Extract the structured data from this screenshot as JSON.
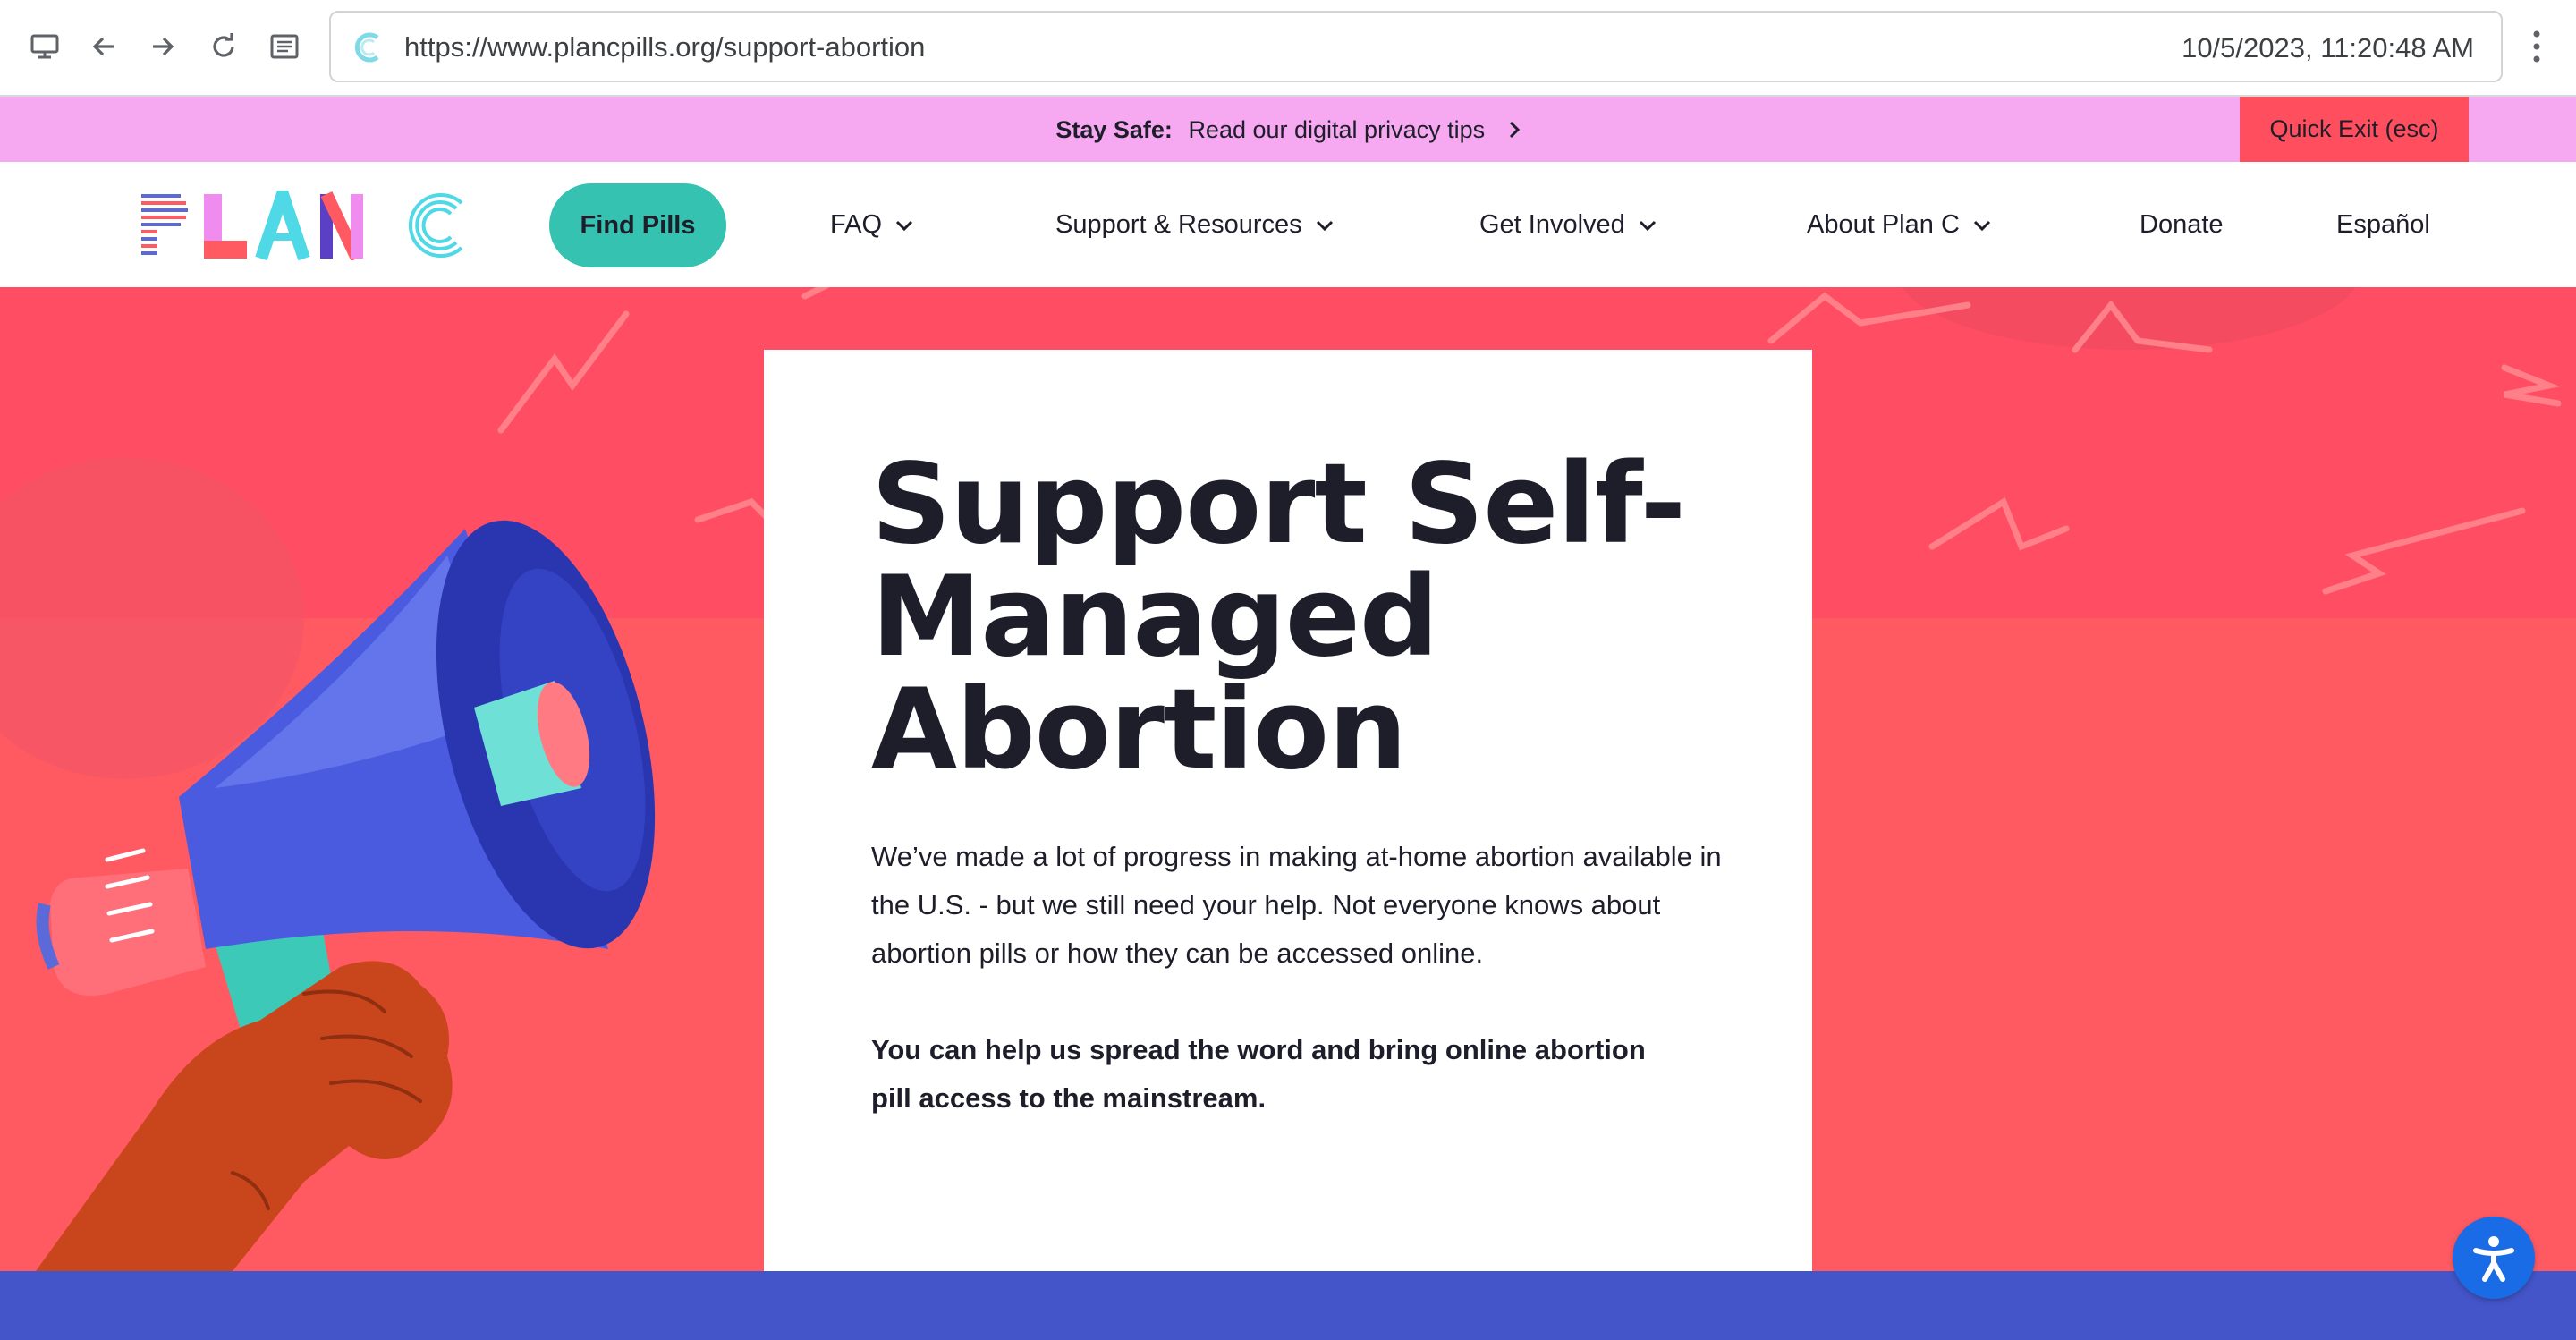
{
  "browser": {
    "url": "https://www.plancpills.org/support-abortion",
    "timestamp": "10/5/2023, 11:20:48 AM",
    "icons": [
      "desktop-icon",
      "back-arrow-icon",
      "forward-arrow-icon",
      "reload-icon",
      "reader-icon",
      "more-vertical-icon"
    ]
  },
  "promo": {
    "bold_label": "Stay Safe:",
    "link_text": "Read our digital privacy tips",
    "quick_exit": "Quick Exit (esc)"
  },
  "nav": {
    "logo_alt": "PLAN C",
    "find_pills": "Find Pills",
    "items": [
      {
        "label": "FAQ",
        "dropdown": true
      },
      {
        "label": "Support & Resources",
        "dropdown": true
      },
      {
        "label": "Get Involved",
        "dropdown": true
      },
      {
        "label": "About Plan C",
        "dropdown": true
      },
      {
        "label": "Donate",
        "dropdown": false
      },
      {
        "label": "Español",
        "dropdown": false
      }
    ]
  },
  "hero": {
    "title": "Support Self-Managed Abortion",
    "paragraph": "We’ve made a lot of progress in making at-home abortion available in the U.S. - but we still need your help. Not everyone knows about abortion pills or how they can be accessed online.",
    "bold_paragraph": "You can help us spread the word and bring online abortion pill access to the mainstream."
  },
  "colors": {
    "promo_bg": "#f6a8f0",
    "quick_exit_bg": "#ff4f5e",
    "find_pills_bg": "#35c2b0",
    "hero_bg": "#ff5a62",
    "footer_band": "#4355c8",
    "accessibility_button": "#1a6be6"
  }
}
